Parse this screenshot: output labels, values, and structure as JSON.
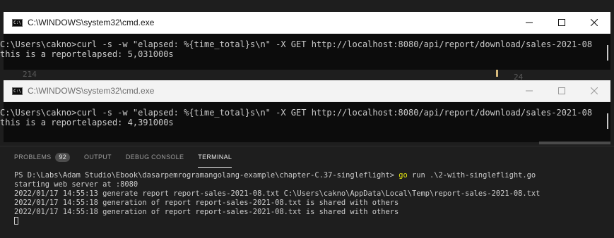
{
  "window1": {
    "title": "C:\\WINDOWS\\system32\\cmd.exe",
    "icon": "cmd-icon",
    "icon_text": "C:\\",
    "lines": [
      "C:\\Users\\cakno>curl -s -w \"elapsed: %{time_total}s\\n\" -X GET http://localhost:8080/api/report/download/sales-2021-08",
      "this is a reportelapsed: 5,031000s"
    ]
  },
  "gap_text": {
    "left_number": "214",
    "right_number": "24"
  },
  "window2": {
    "title": "C:\\WINDOWS\\system32\\cmd.exe",
    "icon": "cmd-icon",
    "icon_text": "C:\\",
    "lines": [
      "C:\\Users\\cakno>curl -s -w \"elapsed: %{time_total}s\\n\" -X GET http://localhost:8080/api/report/download/sales-2021-08",
      "this is a reportelapsed: 4,391000s"
    ]
  },
  "panel": {
    "tabs": [
      {
        "label": "PROBLEMS",
        "badge": "92"
      },
      {
        "label": "OUTPUT"
      },
      {
        "label": "DEBUG CONSOLE"
      },
      {
        "label": "TERMINAL",
        "active": true
      }
    ],
    "terminal": {
      "prompt": "PS D:\\Labs\\Adam Studio\\Ebook\\dasarpemrogramangolang-example\\chapter-C.37-singleflight> ",
      "command_keyword": "go",
      "command_rest": " run .\\2-with-singleflight.go",
      "lines": [
        "starting web server at :8080",
        "2022/01/17 14:55:13 generate report report-sales-2021-08.txt C:\\Users\\cakno\\AppData\\Local\\Temp\\report-sales-2021-08.txt",
        "2022/01/17 14:55:18 generation of report report-sales-2021-08.txt is shared with others",
        "2022/01/17 14:55:18 generation of report report-sales-2021-08.txt is shared with others"
      ]
    }
  },
  "colors": {
    "console_bg": "#0c0c0c",
    "editor_bg": "#1e1e1e",
    "go_keyword": "#e5e510"
  }
}
